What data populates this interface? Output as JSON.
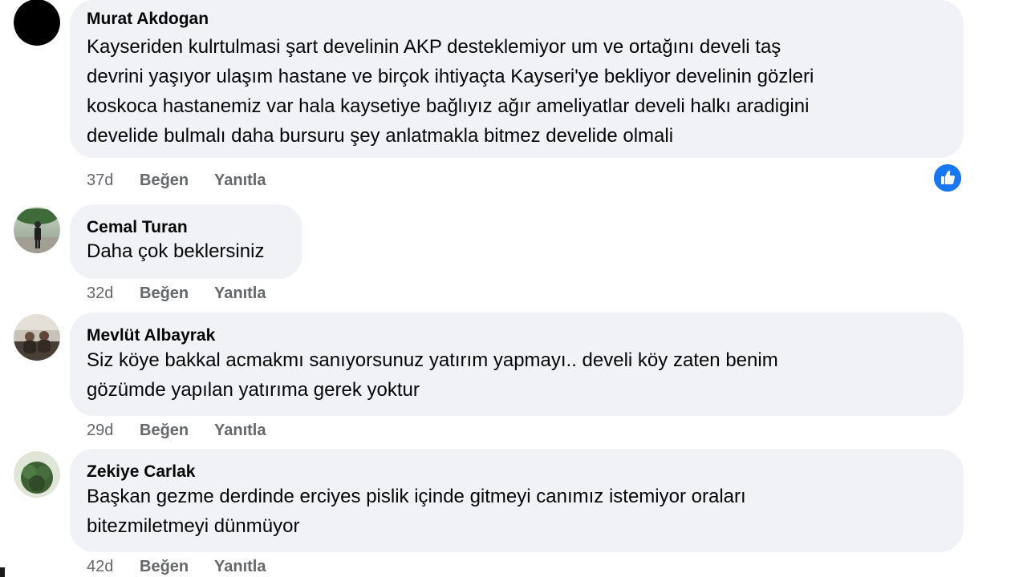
{
  "comments": [
    {
      "author": "Murat Akdogan",
      "lines": [
        "Kayseriden kulrtulmasi şart develinin AKP desteklemiyor um ve ortağını develi taş",
        "devrini yaşıyor ulaşım hastane ve birçok ihtiyaçta Kayseri'ye bekliyor develinin gözleri",
        "koskoca hastanemiz var hala kaysetiye bağlıyız ağır ameliyatlar develi halkı aradigini",
        "develide bulmalı daha bursuru şey anlatmakla bitmez develide olmali"
      ],
      "time": "37d",
      "like_label": "Beğen",
      "reply_label": "Yanıtla",
      "reaction_icon": "like-reaction-icon",
      "reaction_color": "#1877f2"
    },
    {
      "author": "Cemal Turan",
      "lines": [
        "Daha çok beklersiniz"
      ],
      "time": "32d",
      "like_label": "Beğen",
      "reply_label": "Yanıtla"
    },
    {
      "author": "Mevlüt Albayrak",
      "lines": [
        "Siz köye bakkal acmakmı sanıyorsunuz yatırım yapmayı.. develi köy zaten benim",
        "gözümde yapılan yatırıma gerek yoktur"
      ],
      "time": "29d",
      "like_label": "Beğen",
      "reply_label": "Yanıtla"
    },
    {
      "author": "Zekiye Carlak",
      "lines": [
        "Başkan gezme derdinde erciyes pislik içinde gitmeyi canımız istemiyor oraları",
        "bitezmiletmeyi dünmüyor"
      ],
      "time": "42d",
      "like_label": "Beğen",
      "reply_label": "Yanıtla"
    }
  ],
  "colors": {
    "bubble": "#f0f2f5",
    "meta_text": "#65676b",
    "accent": "#1877f2"
  }
}
